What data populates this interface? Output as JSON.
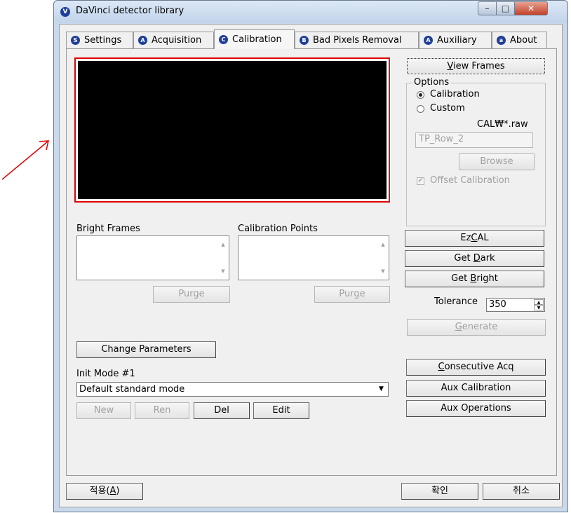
{
  "window": {
    "title": "DaVinci detector library",
    "icon_letter": "V",
    "minimize_icon": "minimize-icon",
    "maximize_icon": "maximize-icon",
    "close_icon": "close-icon"
  },
  "tabs": [
    {
      "letter": "S",
      "label": "Settings"
    },
    {
      "letter": "A",
      "label": "Acquisition"
    },
    {
      "letter": "C",
      "label": "Calibration"
    },
    {
      "letter": "B",
      "label": "Bad Pixels Removal"
    },
    {
      "letter": "A",
      "label": "Auxiliary"
    },
    {
      "letter": "a",
      "label": "About"
    }
  ],
  "annotation": {
    "arrow_color": "#e00000",
    "frame_color": "#e00000"
  },
  "left": {
    "bright_frames_label": "Bright Frames",
    "calibration_points_label": "Calibration Points",
    "purge1": "Purge",
    "purge2": "Purge",
    "change_parameters": "Change Parameters",
    "init_mode_label": "Init Mode #1",
    "init_mode_value": "Default standard mode",
    "new": "New",
    "ren": "Ren",
    "del": "Del",
    "edit": "Edit"
  },
  "right": {
    "view_frames_prefix": "",
    "view_frames_u": "V",
    "view_frames_rest": "iew Frames",
    "options_label": "Options",
    "radio_calibration": "Calibration",
    "radio_custom": "Custom",
    "cal_pattern": "CAL₩*.raw",
    "file_value": "TP_Row_2",
    "browse": "Browse",
    "offset_calibration": "Offset Calibration",
    "ezcal_prefix": "Ez",
    "ezcal_u": "C",
    "ezcal_rest": "AL",
    "get_dark_prefix": "Get ",
    "get_dark_u": "D",
    "get_dark_rest": "ark",
    "get_bright_prefix": "Get ",
    "get_bright_u": "B",
    "get_bright_rest": "right",
    "tolerance_label": "Tolerance",
    "tolerance_value": "350",
    "generate_u": "G",
    "generate_rest": "enerate",
    "consecutive_u": "C",
    "consecutive_rest": "onsecutive Acq",
    "aux_calibration": "Aux Calibration",
    "aux_operations": "Aux Operations"
  },
  "bottom": {
    "apply_prefix": "적용(",
    "apply_u": "A",
    "apply_suffix": ")",
    "ok": "확인",
    "cancel": "취소"
  }
}
